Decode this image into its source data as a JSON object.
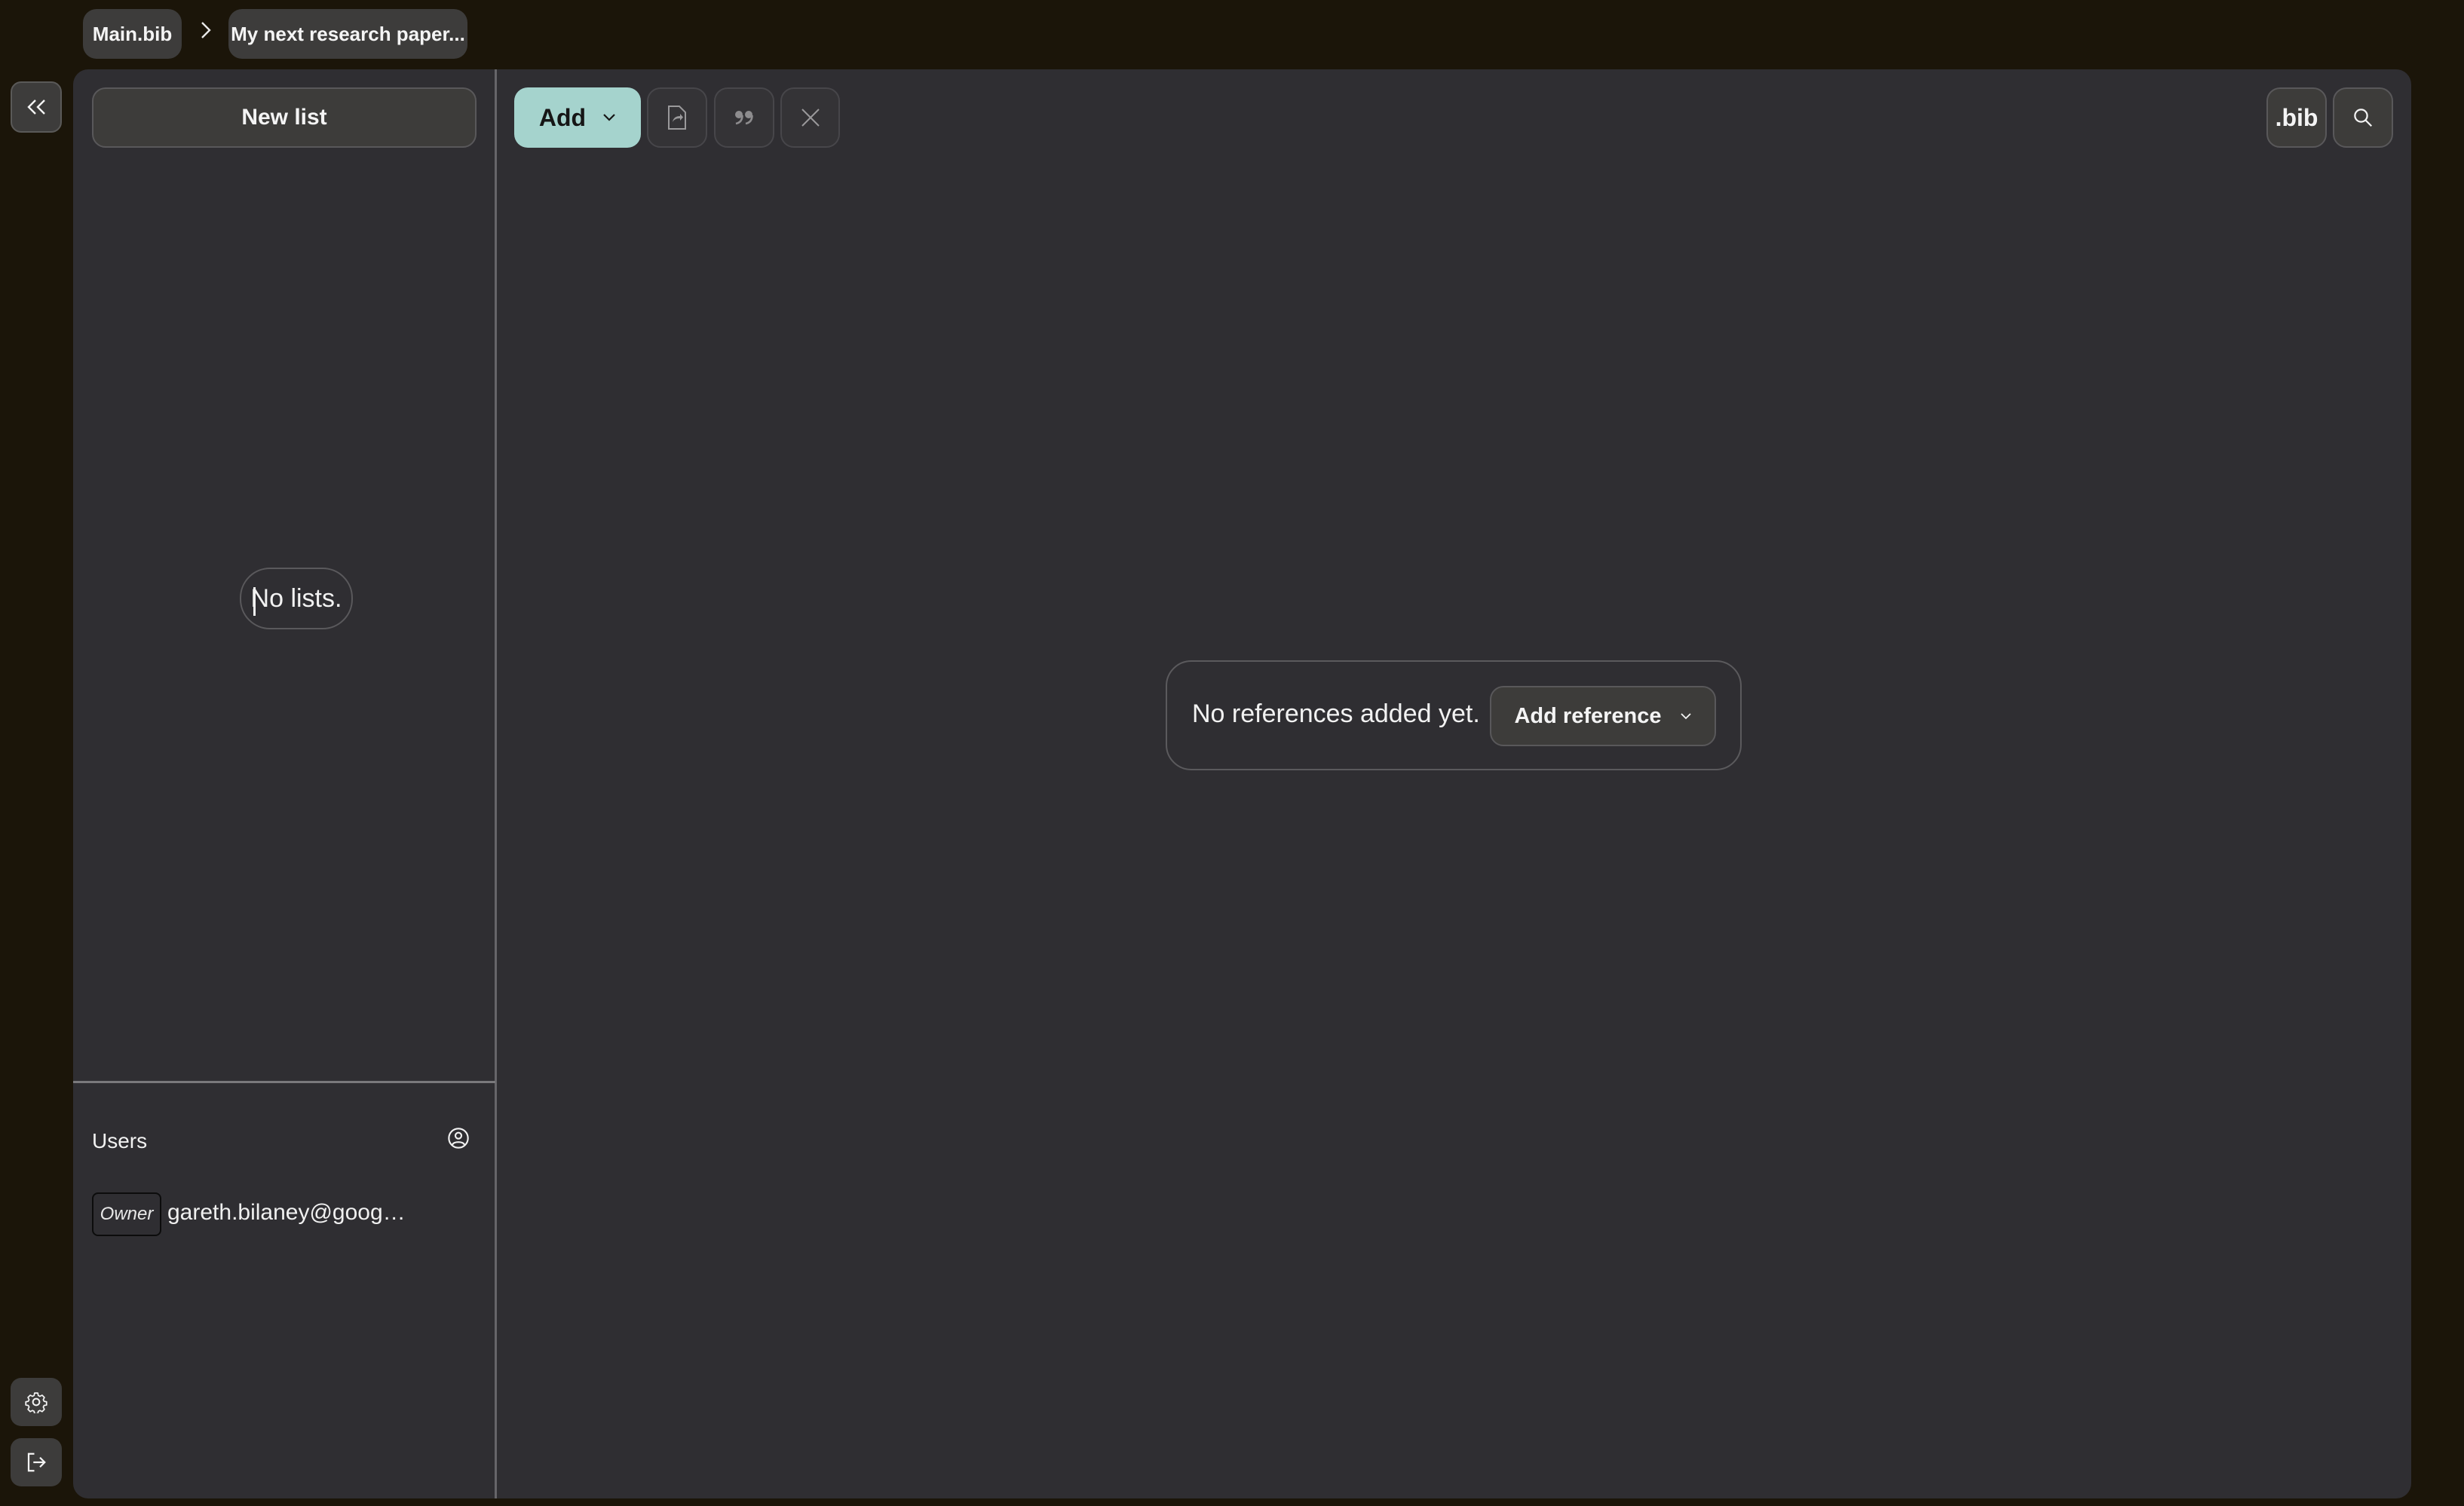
{
  "breadcrumb": {
    "items": [
      {
        "label": "Main.bib"
      },
      {
        "label": "My next research paper..."
      }
    ],
    "separator_icon": "chevron-right-icon"
  },
  "rail": {
    "collapse_icon": "double-chevron-left-icon",
    "settings_icon": "gear-icon",
    "logout_icon": "logout-icon"
  },
  "lists_panel": {
    "new_list_label": "New list",
    "empty_text": "No lists."
  },
  "users_panel": {
    "title": "Users",
    "add_user_icon": "user-circle-icon",
    "users": [
      {
        "role": "Owner",
        "email": "gareth.bilaney@goog…"
      }
    ]
  },
  "toolbar": {
    "add_label": "Add",
    "add_icon": "chevron-down-icon",
    "export_icon": "file-share-icon",
    "cite_icon": "quote-icon",
    "close_icon": "close-icon",
    "bib_label": ".bib",
    "search_icon": "search-icon"
  },
  "main": {
    "empty_text": "No references added yet.",
    "add_reference_label": "Add reference"
  },
  "colors": {
    "background": "#1b1509",
    "panel": "#2f2e32",
    "accent": "#a5d3cd",
    "button": "#3d3c3a"
  }
}
